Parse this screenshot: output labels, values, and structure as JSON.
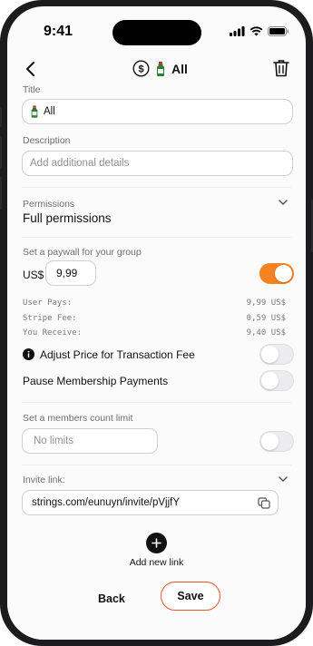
{
  "status_bar": {
    "time": "9:41"
  },
  "nav": {
    "title": "All",
    "coin_icon": "dollar-coin-icon",
    "emoji_icon": "bottle-emoji-icon",
    "back_icon": "chevron-left-icon",
    "delete_icon": "trash-icon"
  },
  "title_section": {
    "label": "Title",
    "value": "All"
  },
  "description_section": {
    "label": "Description",
    "placeholder": "Add additional details"
  },
  "permissions": {
    "label": "Permissions",
    "value": "Full permissions"
  },
  "paywall": {
    "label": "Set a paywall for your group",
    "currency": "US$",
    "price": "9,99",
    "enabled": true,
    "breakdown": [
      {
        "label": "User Pays:",
        "value": "9,99 US$"
      },
      {
        "label": "Stripe Fee:",
        "value": "0,59 US$"
      },
      {
        "label": "You Receive:",
        "value": "9,40 US$"
      }
    ]
  },
  "adjust_price": {
    "label": "Adjust Price for Transaction Fee",
    "enabled": false
  },
  "pause_payments": {
    "label": "Pause Membership Payments",
    "enabled": false
  },
  "members_limit": {
    "label": "Set a members count limit",
    "placeholder": "No limits",
    "enabled": false
  },
  "invite": {
    "label": "Invite link:",
    "url": "strings.com/eunuyn/invite/pVjjfY"
  },
  "add_link": {
    "label": "Add new link"
  },
  "footer": {
    "back_label": "Back",
    "save_label": "Save"
  },
  "colors": {
    "accent": "#f58220",
    "save_border": "#f0522b"
  }
}
